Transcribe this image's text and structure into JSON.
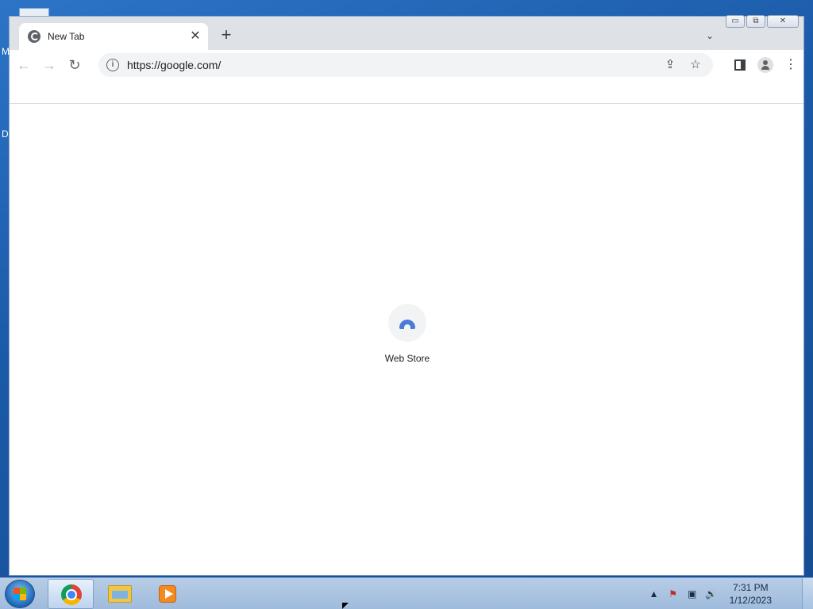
{
  "desktop": {
    "glyphs": [
      "M",
      "D"
    ]
  },
  "window": {
    "tab": {
      "title": "New Tab",
      "close_glyph": "✕",
      "favicon": "globe-icon"
    },
    "new_tab_glyph": "+",
    "tab_search_glyph": "⌄",
    "controls": {
      "minimize": "▭",
      "maximize": "⧉",
      "close": "✕"
    }
  },
  "toolbar": {
    "back_glyph": "←",
    "forward_glyph": "→",
    "reload_glyph": "↻",
    "url": "https://google.com/",
    "info_glyph": "i",
    "share_glyph": "⇪",
    "bookmark_glyph": "☆",
    "menu_glyph": "⋮"
  },
  "content": {
    "shortcut": {
      "label": "Web Store",
      "icon": "web-store-icon"
    }
  },
  "taskbar": {
    "apps": [
      "chrome",
      "file-explorer",
      "media-player"
    ],
    "tray": {
      "arrow_glyph": "▲",
      "flag_glyph": "⚑",
      "network_glyph": "▣",
      "volume_glyph": "🔊"
    },
    "clock": {
      "time": "7:31 PM",
      "date": "1/12/2023"
    }
  }
}
